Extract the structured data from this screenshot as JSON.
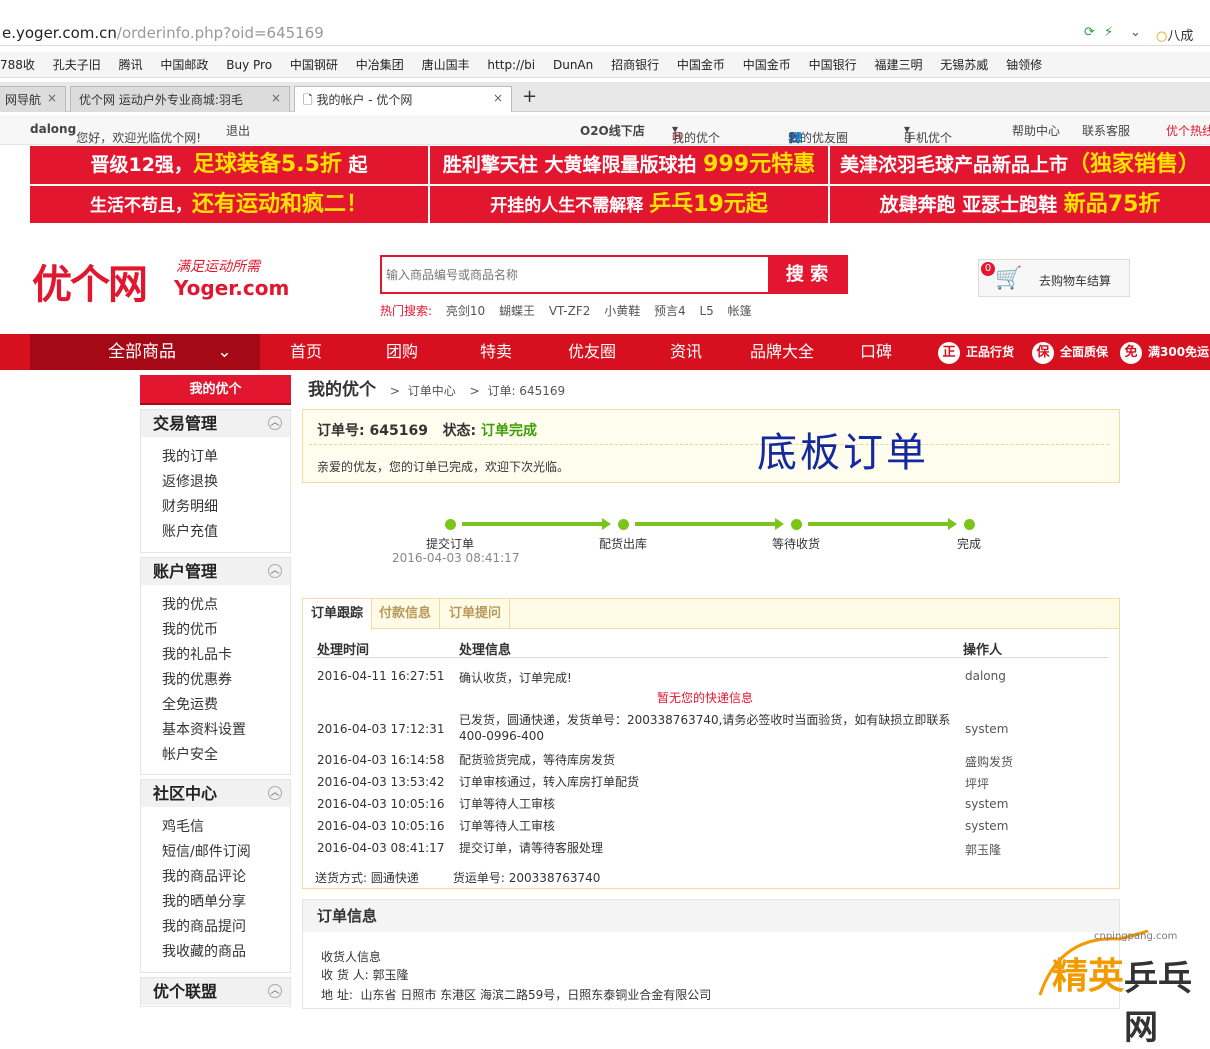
{
  "browser": {
    "url_host": "e.yoger.com.cn",
    "url_path": "/orderinfo.php?oid=645169",
    "right_text": "八成",
    "bookmarks": [
      "788收",
      "孔夫子旧",
      "腾讯",
      "中国邮政",
      "Buy Pro",
      "中国钢研",
      "中冶集团",
      "唐山国丰",
      "http://bi",
      "DunAn",
      "招商银行",
      "中国金币",
      "中国金币",
      "中国银行",
      "福建三明",
      "无锡苏威",
      "铀领修"
    ],
    "tabs": [
      {
        "label": "网导航"
      },
      {
        "label": "优个网 运动户外专业商城:羽毛"
      },
      {
        "label": "我的帐户 - 优个网"
      }
    ],
    "new_tab": "+",
    "close": "×"
  },
  "topnav": {
    "user": "dalong",
    "welcome": "您好，欢迎光临优个网!",
    "logout": "退出",
    "o2o": "O2O线下店",
    "my": "我的优个",
    "circle": "我的优友圈",
    "mobile": "手机优个",
    "help": "帮助中心",
    "service": "联系客服",
    "hot": "优个热线"
  },
  "banners": [
    {
      "a": "晋级12强，",
      "b": "足球装备5.5折",
      "c": " 起"
    },
    {
      "a": "胜利擎天柱 大黄蜂限量版球拍 ",
      "b": "999元特惠",
      "c": ""
    },
    {
      "a": "美津浓羽毛球产品新品上市",
      "b": "（独家销售）",
      "c": ""
    },
    {
      "a": "生活不苟且，",
      "b": "还有运动和疯二！",
      "c": ""
    },
    {
      "a": "开挂的人生不需解释 ",
      "b": "乒乓19元起",
      "c": ""
    },
    {
      "a": "放肆奔跑 亚瑟士跑鞋 ",
      "b": "新品75折",
      "c": ""
    }
  ],
  "logo": {
    "name": "优个网",
    "slogan": "满足运动所需",
    "domain": "Yoger.com"
  },
  "search": {
    "placeholder": "输入商品编号或商品名称",
    "button": "搜 索",
    "hot_label": "热门搜索:",
    "hot": [
      "亮剑10",
      "蝴蝶王",
      "VT-ZF2",
      "小黄鞋",
      "预言4",
      "L5",
      "帐篷"
    ]
  },
  "cart": {
    "count": "0",
    "label": "去购物车结算"
  },
  "mainnav": {
    "all": "全部商品",
    "items": [
      "首页",
      "团购",
      "特卖",
      "优友圈",
      "资讯",
      "品牌大全",
      "口碑"
    ],
    "guarantees": [
      {
        "icon": "正",
        "label": "正品行货"
      },
      {
        "icon": "保",
        "label": "全面质保"
      },
      {
        "icon": "免",
        "label": "满300免运"
      }
    ]
  },
  "sidebar": {
    "header": "我的优个",
    "groups": [
      {
        "title": "交易管理",
        "items": [
          "我的订单",
          "返修退换",
          "财务明细",
          "账户充值"
        ]
      },
      {
        "title": "账户管理",
        "items": [
          "我的优点",
          "我的优币",
          "我的礼品卡",
          "我的优惠券",
          "全免运费",
          "基本资料设置",
          "帐户安全"
        ]
      },
      {
        "title": "社区中心",
        "items": [
          "鸡毛信",
          "短信/邮件订阅",
          "我的商品评论",
          "我的晒单分享",
          "我的商品提问",
          "我收藏的商品"
        ]
      },
      {
        "title": "优个联盟",
        "items": []
      }
    ]
  },
  "breadcrumb": {
    "title": "我的优个",
    "c1": "订单中心",
    "c2": "订单: 645169",
    "sep": ">"
  },
  "order": {
    "no_label": "订单号:",
    "no": "645169",
    "status_label": "状态:",
    "status": "订单完成",
    "message": "亲爱的优友，您的订单已完成，欢迎下次光临。",
    "stamp": "底板订单"
  },
  "progress": {
    "steps": [
      "提交订单",
      "配货出库",
      "等待收货",
      "完成"
    ],
    "submit_time": "2016-04-03 08:41:17"
  },
  "tracking": {
    "tabs": [
      "订单跟踪",
      "付款信息",
      "订单提问"
    ],
    "headers": [
      "处理时间",
      "处理信息",
      "操作人"
    ],
    "rows": [
      {
        "time": "2016-04-11 16:27:51",
        "info": "确认收货，订单完成!",
        "op": "dalong"
      },
      {
        "time": "2016-04-03 17:12:31",
        "info": "已发货，圆通快递，发货单号：200338763740,请务必签收时当面验货，如有缺损立即联系",
        "info2": "400-0996-400",
        "op": "system"
      },
      {
        "time": "2016-04-03 16:14:58",
        "info": "配货验货完成，等待库房发货",
        "op": "盛购发货"
      },
      {
        "time": "2016-04-03 13:53:42",
        "info": "订单审核通过，转入库房打单配货",
        "op": "坪坪"
      },
      {
        "time": "2016-04-03 10:05:16",
        "info": "订单等待人工审核",
        "op": "system"
      },
      {
        "time": "2016-04-03 10:05:16",
        "info": "订单等待人工审核",
        "op": "system"
      },
      {
        "time": "2016-04-03 08:41:17",
        "info": "提交订单，请等待客服处理",
        "op": "郭玉隆"
      }
    ],
    "no_express": "暂无您的快递信息",
    "ship_method_label": "送货方式:",
    "ship_method": "圆通快递",
    "waybill_label": "货运单号:",
    "waybill": "200338763740"
  },
  "orderinfo": {
    "title": "订单信息",
    "receiver_title": "收货人信息",
    "receiver_label": "收 货 人:",
    "receiver": "郭玉隆",
    "address_label": "地    址:",
    "address": "山东省 日照市 东港区 海滨二路59号，日照东泰铜业合金有限公司"
  },
  "watermark": {
    "site": "cnpingpang.com",
    "a": "精英",
    "b": "乒乓网"
  },
  "colors": {
    "brand_red": "#e3162f",
    "nav_red": "#d6101e",
    "progress_green": "#7bc41a",
    "status_green": "#3e9d07",
    "stamp_blue": "#1428a0"
  }
}
